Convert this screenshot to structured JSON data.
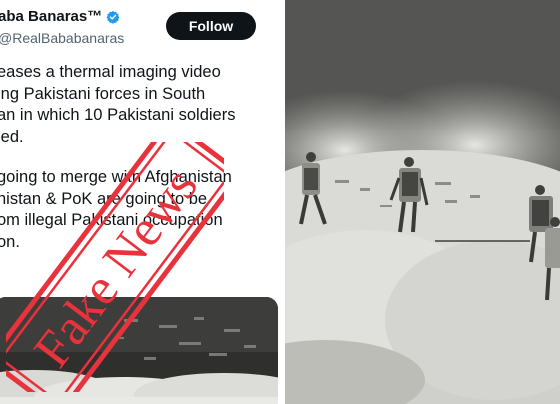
{
  "tweet": {
    "author_name": "aba Banaras™",
    "author_handle": "RealBababanaras",
    "follow_label": "Follow",
    "text_lines": [
      "eases a thermal imaging video",
      "ing Pakistani forces in South",
      "an in which 10 Pakistani soldiers",
      "led."
    ],
    "text_lines_2": [
      "going to merge with Afghanistan",
      "histan & PoK are going to be",
      "om illegal Pakistani occupation",
      "on."
    ]
  },
  "stamp": {
    "label": "Fake News",
    "color": "#e8323c"
  },
  "colors": {
    "follow_bg": "#0f1419",
    "verified": "#1d9bf0",
    "text": "#0f1419",
    "handle": "#536471"
  },
  "icons": {
    "verified": "verified-badge-icon"
  }
}
